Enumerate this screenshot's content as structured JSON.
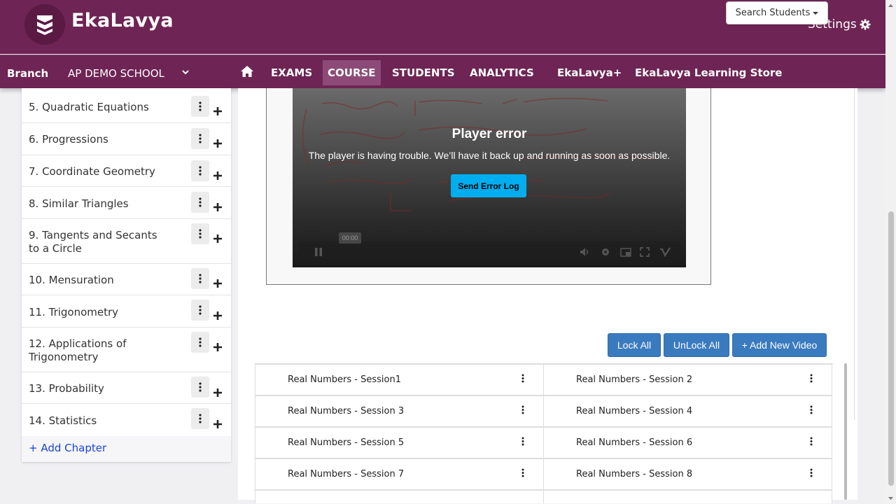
{
  "header": {
    "app_name": "EkaLavya",
    "search_students_label": "Search Students",
    "settings_label": "Settings",
    "brand_color": "#6e2454"
  },
  "nav": {
    "branch_label": "Branch",
    "school": "AP DEMO SCHOOL",
    "items": [
      {
        "label": "EXAMS",
        "active": false
      },
      {
        "label": "COURSE",
        "active": true
      },
      {
        "label": "STUDENTS",
        "active": false
      },
      {
        "label": "ANALYTICS",
        "active": false
      },
      {
        "label": "EkaLavya+",
        "active": false
      },
      {
        "label": "EkaLavya Learning Store",
        "active": false
      }
    ]
  },
  "chapters": {
    "items": [
      {
        "name": "5. Quadratic Equations"
      },
      {
        "name": "6. Progressions"
      },
      {
        "name": "7. Coordinate Geometry"
      },
      {
        "name": "8. Similar Triangles"
      },
      {
        "name": "9. Tangents and Secants to a Circle"
      },
      {
        "name": "10. Mensuration"
      },
      {
        "name": "11. Trigonometry"
      },
      {
        "name": "12. Applications of Trigonometry"
      },
      {
        "name": "13. Probability"
      },
      {
        "name": "14. Statistics"
      }
    ],
    "add_label": "+ Add Chapter"
  },
  "player": {
    "error_title": "Player error",
    "error_message": "The player is having trouble. We’ll have it back up and running as soon as possible.",
    "send_log_label": "Send Error Log",
    "time": "00:00"
  },
  "actions": {
    "lock_all": "Lock All",
    "unlock_all": "UnLock All",
    "add_video": "+ Add New Video"
  },
  "sessions": [
    "Real Numbers - Session1",
    "Real Numbers - Session 2",
    "Real Numbers - Session 3",
    "Real Numbers - Session 4",
    "Real Numbers - Session 5",
    "Real Numbers - Session 6",
    "Real Numbers - Session 7",
    "Real Numbers - Session 8"
  ]
}
